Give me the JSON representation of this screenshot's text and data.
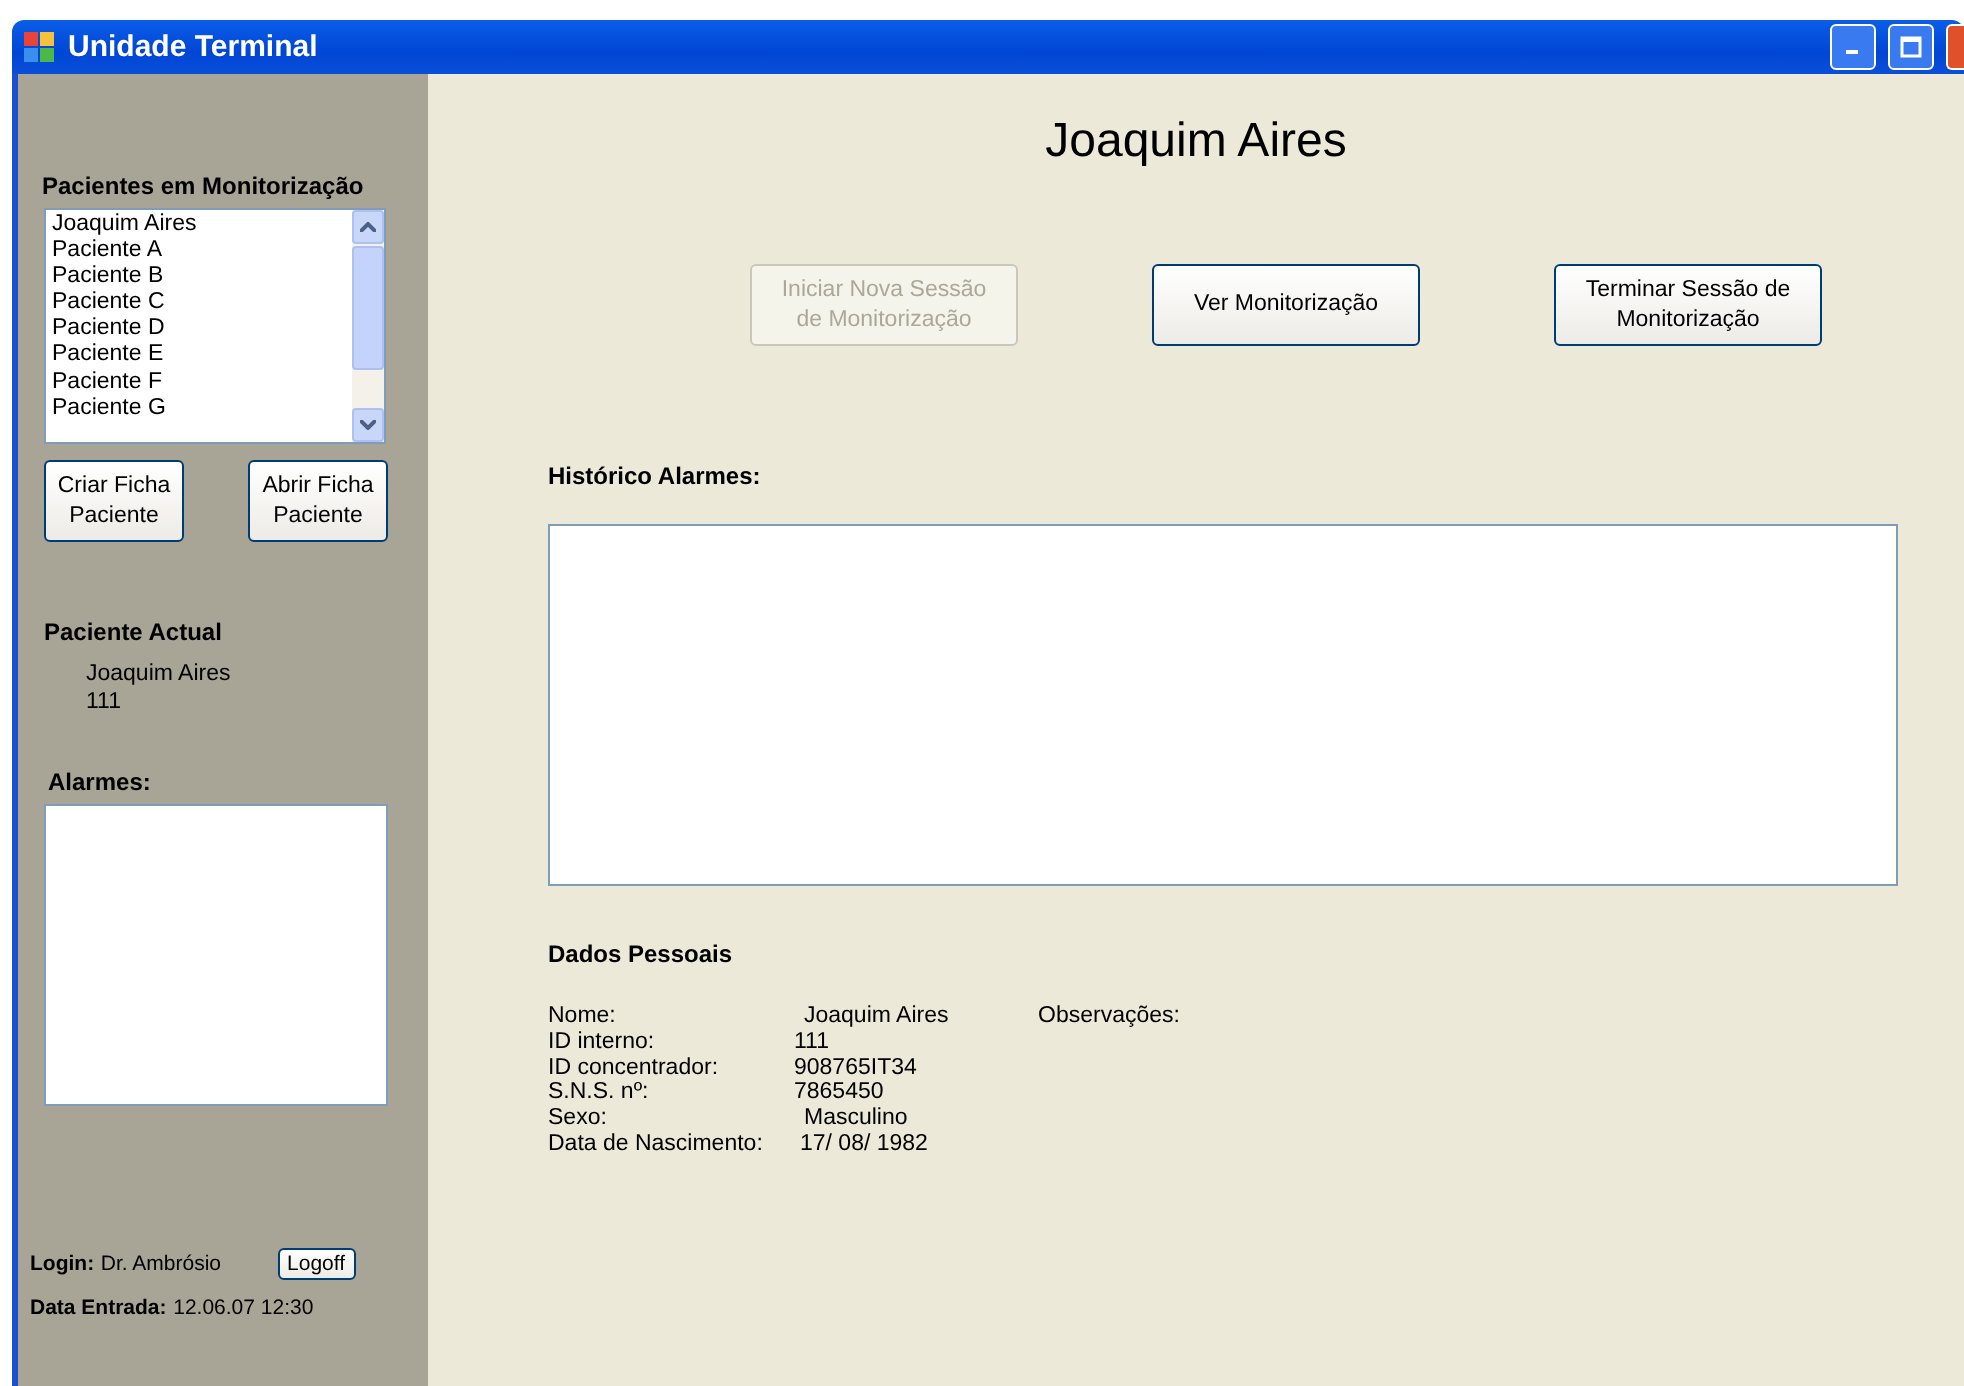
{
  "window": {
    "title": "Unidade Terminal"
  },
  "sidebar": {
    "patients_title": "Pacientes em Monitorização",
    "patients": [
      "Joaquim Aires",
      "Paciente A",
      "Paciente B",
      "Paciente C",
      "Paciente D",
      "Paciente E",
      "Paciente F",
      "Paciente G"
    ],
    "buttons": [
      "Criar Ficha Paciente",
      "Abrir Ficha Paciente"
    ],
    "current_title": "Paciente Actual",
    "current_lines": [
      "Joaquim Aires",
      "111"
    ],
    "alarms_label": "Alarmes:",
    "login_label": "Login:",
    "login_value": "Dr. Ambrósio",
    "logoff": "Logoff",
    "entry_label": "Data Entrada:",
    "entry_value": "12.06.07 12:30"
  },
  "main": {
    "title": "Joaquim Aires",
    "buttons": [
      {
        "label": "Iniciar Nova Sessão de Monitorização",
        "disabled": true
      },
      {
        "label": "Ver Monitorização",
        "disabled": false
      },
      {
        "label": "Terminar Sessão de Monitorização",
        "disabled": false
      }
    ],
    "history_label": "Histórico Alarmes:",
    "personal_title": "Dados Pessoais",
    "fields": [
      {
        "label": "Nome:",
        "value": "Joaquim Aires"
      },
      {
        "label": "ID interno:",
        "value": "111"
      },
      {
        "label": "ID concentrador:",
        "value": "908765IT34"
      },
      {
        "label": "S.N.S. nº:",
        "value": "7865450"
      },
      {
        "label": "Sexo:",
        "value": "Masculino"
      },
      {
        "label": "Data de Nascimento:",
        "value": "17/ 08/ 1982"
      }
    ],
    "notes_label": "Observações:"
  }
}
